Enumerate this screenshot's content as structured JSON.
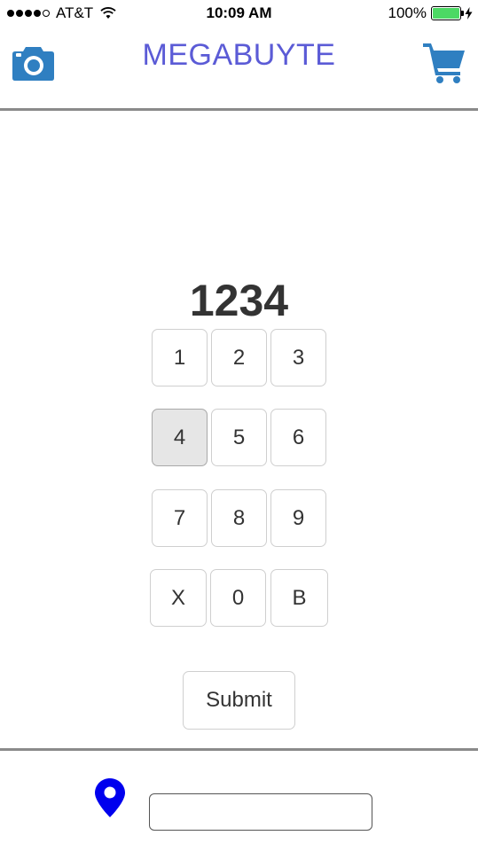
{
  "status_bar": {
    "carrier": "AT&T",
    "time": "10:09 AM",
    "battery_percent": "100%",
    "signal_bars_filled": 4,
    "signal_bars_total": 5,
    "battery_color": "#4cd964",
    "icons": [
      "wifi-icon",
      "battery-icon",
      "charging-bolt-icon"
    ]
  },
  "header": {
    "title": "MEGABUYTE",
    "title_color": "#5b5bd6",
    "left_icon": "camera-icon",
    "right_icon": "cart-icon",
    "icon_color": "#2f7fc1"
  },
  "pin": {
    "value": "1234"
  },
  "keypad": {
    "keys": [
      "1",
      "2",
      "3",
      "4",
      "5",
      "6",
      "7",
      "8",
      "9",
      "X",
      "0",
      "B"
    ],
    "active_key": "4"
  },
  "submit": {
    "label": "Submit"
  },
  "footer": {
    "location_icon": "map-pin-icon",
    "location_icon_color": "#0000ee",
    "location_input_value": "",
    "location_input_placeholder": ""
  }
}
